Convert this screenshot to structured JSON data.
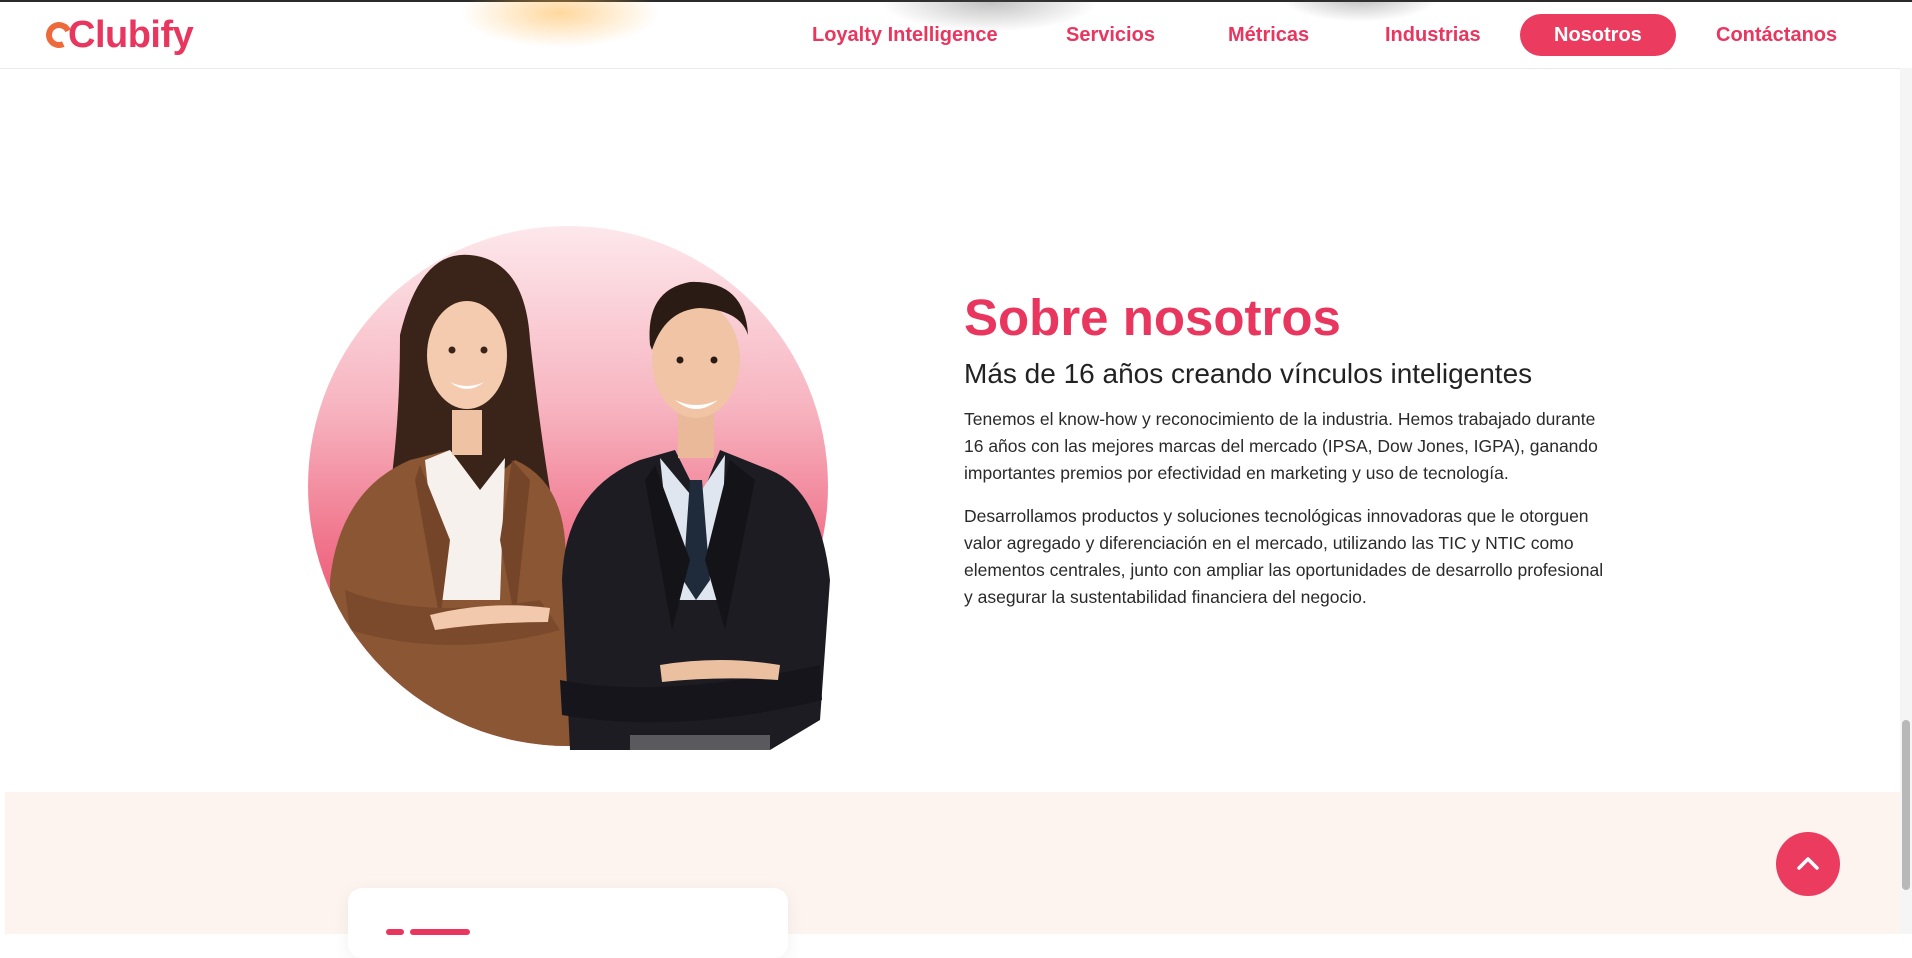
{
  "header": {
    "logo_text": "Clubify",
    "nav": [
      {
        "label": "Loyalty Intelligence"
      },
      {
        "label": "Servicios"
      },
      {
        "label": "Métricas"
      },
      {
        "label": "Industrias"
      },
      {
        "label": "Nosotros",
        "active": true
      },
      {
        "label": "Contáctanos"
      }
    ]
  },
  "about": {
    "title": "Sobre nosotros",
    "subtitle": "Más de 16 años creando vínculos inteligentes",
    "paragraph_1": "Tenemos el know-how y reconocimiento de la industria. Hemos trabajado durante 16 años con las mejores marcas del mercado (IPSA, Dow Jones, IGPA), ganando importantes premios por efectividad en marketing y uso de tecnología.",
    "paragraph_2": "Desarrollamos productos y soluciones tecnológicas innovadoras que le otorguen valor agregado y diferenciación en el mercado, utilizando las TIC y NTIC como elementos centrales, junto con ampliar las oportunidades de desarrollo profesional y asegurar la sustentabilidad financiera del negocio."
  },
  "colors": {
    "brand": "#e8365f",
    "brand_button": "#eb3b5f",
    "band_background": "#fdf4f0",
    "logo_accent": "#ef6a3a"
  },
  "icons": {
    "scroll_top": "chevron-up-icon",
    "logo_mark": "clubify-logo-icon"
  }
}
